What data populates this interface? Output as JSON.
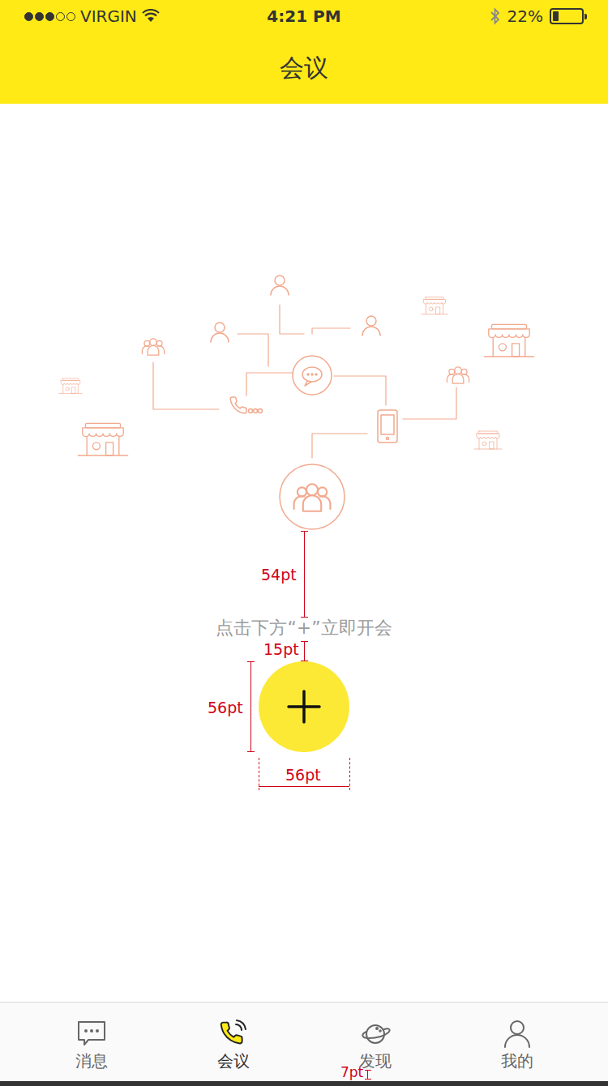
{
  "status_bar": {
    "carrier": "VIRGIN",
    "time": "4:21 PM",
    "battery": "22%",
    "battery_level": 0.22,
    "signal_level": 0.6
  },
  "header": {
    "title": "会议"
  },
  "empty_state": {
    "hint": "点击下方“+”立即开会"
  },
  "spec_marks": {
    "text_gap": "54pt",
    "button_gap": "15pt",
    "button_height": "56pt",
    "button_width": "56pt",
    "label_gap": "7pt"
  },
  "tabs": [
    {
      "label": "消息",
      "selected": false,
      "kind": "message"
    },
    {
      "label": "会议",
      "selected": true,
      "kind": "meeting"
    },
    {
      "label": "发现",
      "selected": false,
      "kind": "discover"
    },
    {
      "label": "我的",
      "selected": false,
      "kind": "mine"
    }
  ]
}
